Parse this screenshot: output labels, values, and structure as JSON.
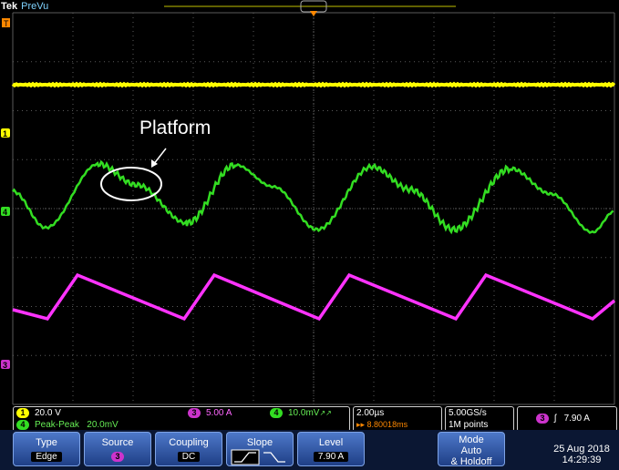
{
  "header": {
    "brand": "Tek",
    "mode": "PreVu"
  },
  "annotation": {
    "text": "Platform"
  },
  "markers": {
    "ch1": "1",
    "ch4": "4",
    "ch3": "3",
    "trigger": "T"
  },
  "readouts": {
    "ch1_num": "1",
    "ch1_scale": "20.0 V",
    "ch3_num": "3",
    "ch3_scale": "5.00 A",
    "ch4_num": "4",
    "ch4_scale": "10.0mV",
    "ch4_suffix": "↗↗",
    "meas_num": "4",
    "meas_label": "Peak-Peak",
    "meas_value": "20.0mV",
    "timebase": "2.00µs",
    "trigger_pos": "▸▸ 8.80018ms",
    "sample_rate": "5.00GS/s",
    "record_length": "1M points",
    "trig_src": "3",
    "trig_slope_glyph": "ʃ",
    "trig_level": "7.90 A"
  },
  "softkeys": {
    "type_label": "Type",
    "type_value": "Edge",
    "source_label": "Source",
    "source_value": "3",
    "coupling_label": "Coupling",
    "coupling_value": "DC",
    "slope_label": "Slope",
    "level_label": "Level",
    "level_value": "7.90 A",
    "mode_label": "Mode",
    "mode_value1": "Auto",
    "mode_value2": "& Holdoff"
  },
  "datetime": {
    "date": "25 Aug 2018",
    "time": "14:29:39"
  },
  "colors": {
    "ch1": "#ffff00",
    "ch4": "#33dd22",
    "ch3": "#ff33ff",
    "grid": "#555555",
    "trigger": "#ff8800"
  }
}
